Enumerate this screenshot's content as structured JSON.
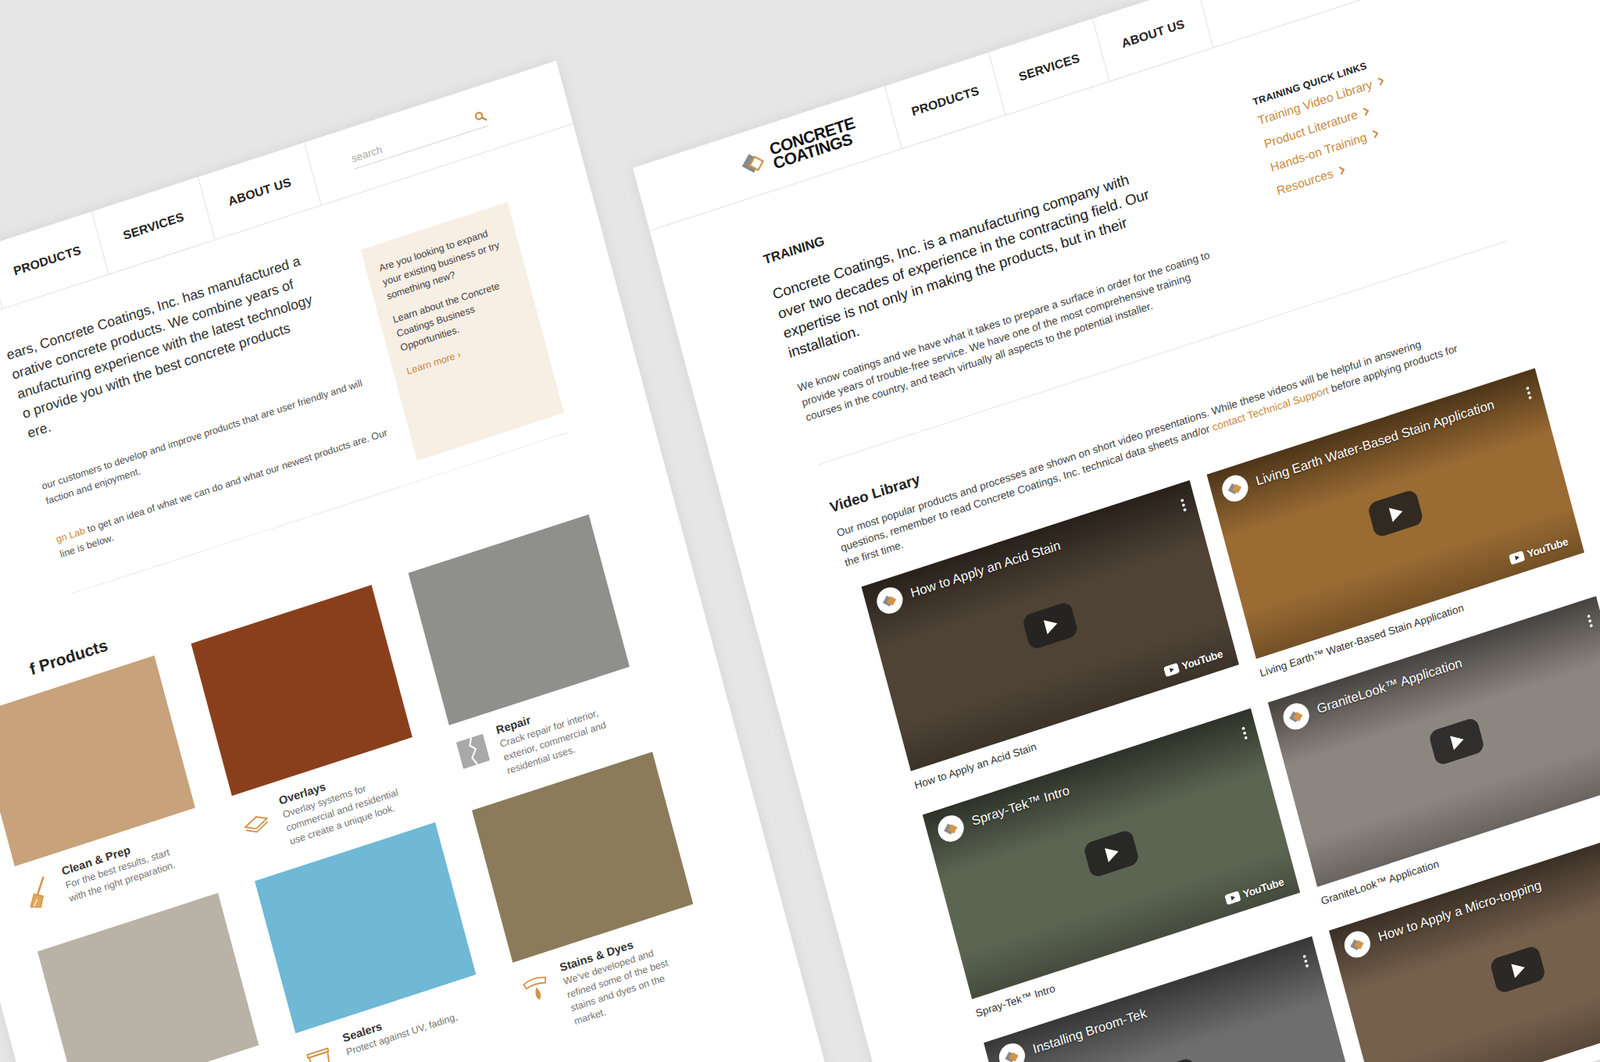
{
  "home_page": {
    "nav": [
      {
        "label": "PRODUCTS"
      },
      {
        "label": "SERVICES"
      },
      {
        "label": "ABOUT US"
      }
    ],
    "search": {
      "placeholder": "search"
    },
    "intro_lines": [
      "ears, Concrete Coatings, Inc. has manufactured a",
      "orative concrete products. We combine years of",
      "anufacturing experience with the latest technology",
      "o provide you with the best concrete products",
      "ere."
    ],
    "body_paragraphs": [
      [
        [
          {
            "text": "our customers to develop and improve products that are user friendly and will",
            "link": false
          }
        ],
        [
          {
            "text": "faction and enjoyment.",
            "link": false
          }
        ]
      ],
      [
        [
          {
            "text": "gn Lab",
            "link": true
          },
          {
            "text": " to get an idea of what we can do and what our newest products are. Our",
            "link": false
          }
        ],
        [
          {
            "text": "line is below.",
            "link": false
          }
        ]
      ]
    ],
    "promo": {
      "paragraphs": [
        "Are you looking to expand your existing business or try something new?",
        "Learn about the Concrete Coatings Business Opportunities."
      ],
      "link": "Learn more ›"
    },
    "products_heading": "f Products",
    "products": [
      {
        "kind": "clean",
        "title": "Clean & Prep",
        "desc": [
          "For the best results, start",
          "with the right preparation."
        ],
        "color": "#c7a27a"
      },
      {
        "kind": "overlay",
        "title": "Overlays",
        "desc": [
          "Overlay systems for",
          "commercial and residential",
          "use create a unique look."
        ],
        "color": "#8a3f1c"
      },
      {
        "kind": "repair",
        "title": "Repair",
        "desc": [
          "Crack repair for interior,",
          "exterior, commercial and",
          "residential uses."
        ],
        "color": "#8f8f8c"
      },
      {
        "kind": "plain",
        "title": "",
        "desc": [],
        "color": "#b9b2a6"
      },
      {
        "kind": "sealer",
        "title": "Sealers",
        "desc": [
          "Protect against UV, fading,"
        ],
        "color": "#6fb8d6"
      },
      {
        "kind": "stain",
        "title": "Stains & Dyes",
        "desc": [
          "We've developed and",
          "refined some of the best",
          "stains and dyes on the",
          "market."
        ],
        "color": "#8b7b5a"
      }
    ]
  },
  "training_page": {
    "logo": [
      "CONCRETE",
      "COATINGS"
    ],
    "nav": [
      {
        "label": "PRODUCTS"
      },
      {
        "label": "SERVICES"
      },
      {
        "label": "ABOUT US"
      }
    ],
    "heading": "TRAINING",
    "lead_lines": [
      "Concrete Coatings, Inc. is a manufacturing company with",
      "over two decades of experience in the contracting field. Our",
      "expertise is not only in making the products, but in their",
      "installation."
    ],
    "body_lines": [
      "We know coatings and we have what it takes to prepare a surface in order for the coating to",
      "provide years of trouble-free service. We have one of the most comprehensive training",
      "courses in the country, and teach virtually all aspects to the potential installer."
    ],
    "quick_links": {
      "title": "TRAINING QUICK LINKS",
      "items": [
        "Training Video Library",
        "Product Literature",
        "Hands-on Training",
        "Resources"
      ]
    },
    "video_library": {
      "heading": "Video Library",
      "desc_lines": [
        [
          {
            "text": "Our most popular products and processes are shown on short video presentations. While these videos will be helpful in answering",
            "link": false
          }
        ],
        [
          {
            "text": "questions, remember to read Concrete Coatings, Inc. technical data sheets and/or ",
            "link": false
          },
          {
            "text": "contact Technical Support",
            "link": true
          },
          {
            "text": " before applying products for",
            "link": false
          }
        ],
        [
          {
            "text": "the first time.",
            "link": false
          }
        ]
      ],
      "videos": [
        {
          "title": "How to Apply an Acid Stain",
          "caption": "How to Apply an Acid Stain",
          "badge": "YouTube",
          "color": "#4f4336"
        },
        {
          "title": "Living Earth Water-Based Stain Application",
          "caption": "Living Earth™ Water-Based Stain Application",
          "badge": "YouTube",
          "color": "#9a6b33"
        },
        {
          "title": "Spray-Tek™ Intro",
          "caption": "Spray-Tek™ Intro",
          "badge": "YouTube",
          "color": "#5c6552"
        },
        {
          "title": "GraniteLook™ Application",
          "caption": "GraniteLook™ Application",
          "badge": "",
          "color": "#8c8680"
        },
        {
          "title": "Installing Broom-Tek",
          "caption": "",
          "badge": "",
          "color": "#6e6e6e"
        },
        {
          "title": "How to Apply a Micro-topping",
          "caption": "",
          "badge": "",
          "color": "#75604c"
        }
      ]
    }
  }
}
